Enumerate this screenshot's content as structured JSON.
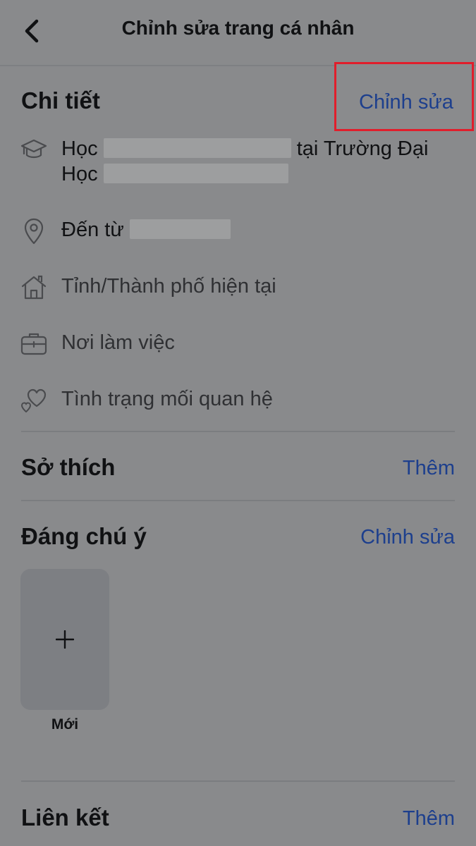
{
  "header": {
    "title": "Chỉnh sửa trang cá nhân",
    "back_icon": "chevron-left-icon"
  },
  "details": {
    "title": "Chi tiết",
    "action": "Chỉnh sửa",
    "highlight_color": "#e11e2b",
    "items": [
      {
        "icon": "graduation-cap-icon",
        "line1_prefix": "Học",
        "line1_suffix": "tại Trường Đại",
        "line2_prefix": "Học"
      },
      {
        "icon": "location-pin-icon",
        "text": "Đến từ"
      },
      {
        "icon": "home-icon",
        "text": "Tỉnh/Thành phố hiện tại"
      },
      {
        "icon": "briefcase-icon",
        "text": "Nơi làm việc"
      },
      {
        "icon": "hearts-icon",
        "text": "Tình trạng mối quan hệ"
      }
    ]
  },
  "hobbies": {
    "title": "Sở thích",
    "action": "Thêm"
  },
  "featured": {
    "title": "Đáng chú ý",
    "action": "Chỉnh sửa",
    "new_label": "Mới",
    "plus_icon": "plus-icon"
  },
  "links": {
    "title": "Liên kết",
    "action": "Thêm"
  },
  "colors": {
    "background": "#898a8c",
    "link_blue": "#1d3f8d",
    "text": "#101113"
  }
}
